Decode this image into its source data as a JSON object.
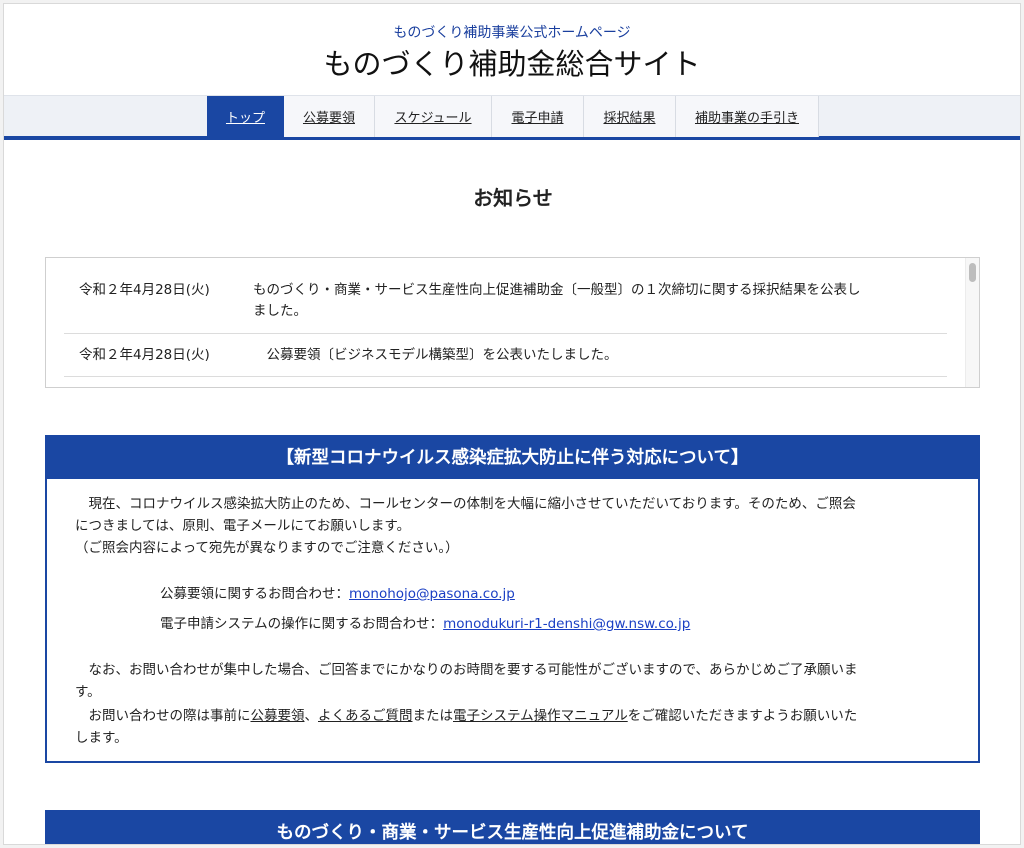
{
  "header": {
    "tagline": "ものづくり補助事業公式ホームページ",
    "title": "ものづくり補助金総合サイト"
  },
  "nav": {
    "items": [
      {
        "label": "トップ",
        "active": true
      },
      {
        "label": "公募要領",
        "active": false
      },
      {
        "label": "スケジュール",
        "active": false
      },
      {
        "label": "電子申請",
        "active": false
      },
      {
        "label": "採択結果",
        "active": false
      },
      {
        "label": "補助事業の手引き",
        "active": false
      }
    ]
  },
  "news": {
    "heading": "お知らせ",
    "items": [
      {
        "date": "令和２年4月28日(火)",
        "text_line1": "ものづくり・商業・サービス生産性向上促進補助金〔一般型〕の１次締切に関する採択結果を公表し",
        "text_line2": "ました。"
      },
      {
        "date": "令和２年4月28日(火)",
        "text_line1": "　公募要領〔ビジネスモデル構築型〕を公表いたしました。",
        "text_line2": ""
      }
    ]
  },
  "covid": {
    "title": "【新型コロナウイルス感染症拡大防止に伴う対応について】",
    "para1_line1": "　現在、コロナウイルス感染拡大防止のため、コールセンターの体制を大幅に縮小させていただいております。そのため、ご照会",
    "para1_line2": "につきましては、原則、電子メールにてお願いします。",
    "para1_line3": "（ご照会内容によって宛先が異なりますのでご注意ください。）",
    "contact1_label": "公募要領に関するお問合わせ：",
    "contact1_email": "monohojo@pasona.co.jp",
    "contact2_label": "電子申請システムの操作に関するお問合わせ：",
    "contact2_email": "monodukuri-r1-denshi@gw.nsw.co.jp",
    "para2_line1": "　なお、お問い合わせが集中した場合、ご回答までにかなりのお時間を要する可能性がございますので、あらかじめご了承願いま",
    "para2_line2": "す。",
    "para3_prefix": "　お問い合わせの際は事前に",
    "link_guidelines": "公募要領",
    "sep1": "、",
    "link_faq": "よくあるご質問",
    "sep2": "または",
    "link_manual": "電子システム操作マニュアル",
    "para3_suffix": "をご確認いただきますようお願いいた",
    "para3_line2": "します。"
  },
  "section2": {
    "title": "ものづくり・商業・サービス生産性向上促進補助金について"
  },
  "colors": {
    "brand_blue": "#1a47a3",
    "link_blue": "#1a3fc4"
  }
}
